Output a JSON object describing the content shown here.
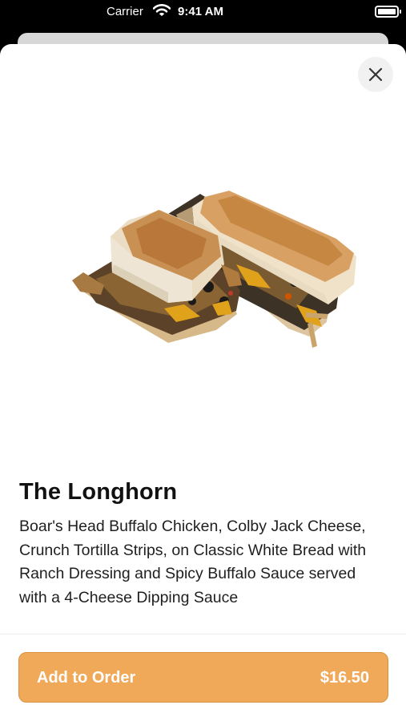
{
  "status_bar": {
    "carrier": "Carrier",
    "time": "9:41 AM"
  },
  "product": {
    "name": "The Longhorn",
    "description": "Boar's Head Buffalo Chicken, Colby Jack Cheese, Crunch Tortilla Strips, on Classic White Bread with Ranch Dressing and Spicy Buffalo Sauce served with a 4-Cheese Dipping Sauce",
    "image": "sandwich-photo"
  },
  "actions": {
    "close_icon": "close-icon",
    "add_label": "Add to Order",
    "price": "$16.50"
  },
  "colors": {
    "accent": "#f0a959",
    "accent_border": "#d99240",
    "text_primary": "#111111",
    "background": "#ffffff"
  }
}
